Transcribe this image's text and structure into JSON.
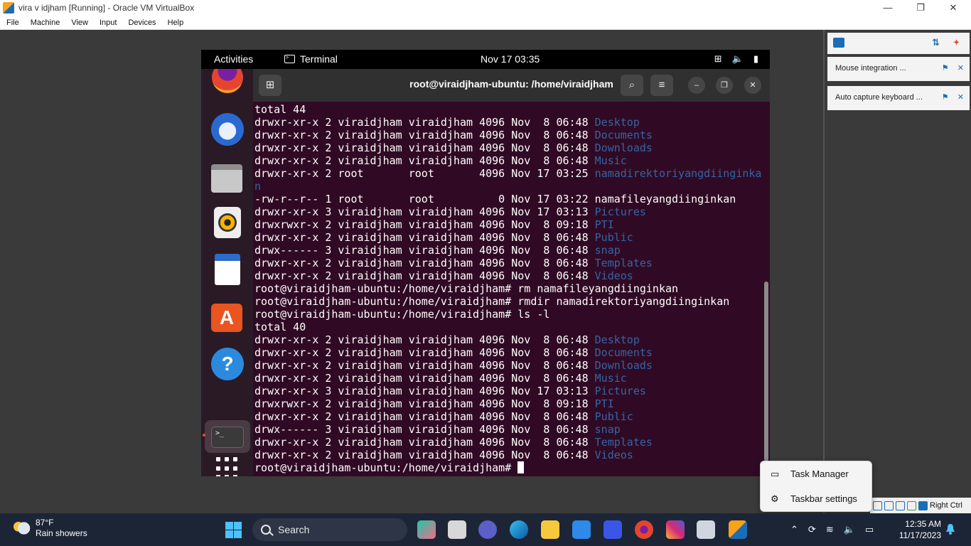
{
  "host_window": {
    "title": "vira v idjham  [Running] - Oracle VM VirtualBox",
    "controls": {
      "minimize": "—",
      "maximize": "❐",
      "close": "✕"
    },
    "menu": [
      "File",
      "Machine",
      "View",
      "Input",
      "Devices",
      "Help"
    ]
  },
  "guest": {
    "topbar": {
      "activities": "Activities",
      "app_name": "Terminal",
      "clock": "Nov 17  03:35"
    },
    "terminal": {
      "title": "root@viraidjham-ubuntu: /home/viraidjham",
      "lines": [
        [
          {
            "t": "total 44"
          }
        ],
        [
          {
            "t": "drwxr-xr-x 2 viraidjham viraidjham 4096 Nov  8 06:48 "
          },
          {
            "t": "Desktop",
            "d": true
          }
        ],
        [
          {
            "t": "drwxr-xr-x 2 viraidjham viraidjham 4096 Nov  8 06:48 "
          },
          {
            "t": "Documents",
            "d": true
          }
        ],
        [
          {
            "t": "drwxr-xr-x 2 viraidjham viraidjham 4096 Nov  8 06:48 "
          },
          {
            "t": "Downloads",
            "d": true
          }
        ],
        [
          {
            "t": "drwxr-xr-x 2 viraidjham viraidjham 4096 Nov  8 06:48 "
          },
          {
            "t": "Music",
            "d": true
          }
        ],
        [
          {
            "t": "drwxr-xr-x 2 root       root       4096 Nov 17 03:25 "
          },
          {
            "t": "namadirektoriyangdiinginka",
            "d": true
          }
        ],
        [
          {
            "t": "n",
            "d": true
          }
        ],
        [
          {
            "t": "-rw-r--r-- 1 root       root          0 Nov 17 03:22 namafileyangdiinginkan"
          }
        ],
        [
          {
            "t": "drwxr-xr-x 3 viraidjham viraidjham 4096 Nov 17 03:13 "
          },
          {
            "t": "Pictures",
            "d": true
          }
        ],
        [
          {
            "t": "drwxrwxr-x 2 viraidjham viraidjham 4096 Nov  8 09:18 "
          },
          {
            "t": "PTI",
            "d": true
          }
        ],
        [
          {
            "t": "drwxr-xr-x 2 viraidjham viraidjham 4096 Nov  8 06:48 "
          },
          {
            "t": "Public",
            "d": true
          }
        ],
        [
          {
            "t": "drwx------ 3 viraidjham viraidjham 4096 Nov  8 06:48 "
          },
          {
            "t": "snap",
            "d": true
          }
        ],
        [
          {
            "t": "drwxr-xr-x 2 viraidjham viraidjham 4096 Nov  8 06:48 "
          },
          {
            "t": "Templates",
            "d": true
          }
        ],
        [
          {
            "t": "drwxr-xr-x 2 viraidjham viraidjham 4096 Nov  8 06:48 "
          },
          {
            "t": "Videos",
            "d": true
          }
        ],
        [
          {
            "t": "root@viraidjham-ubuntu:/home/viraidjham# rm namafileyangdiinginkan"
          }
        ],
        [
          {
            "t": "root@viraidjham-ubuntu:/home/viraidjham# rmdir namadirektoriyangdiinginkan"
          }
        ],
        [
          {
            "t": "root@viraidjham-ubuntu:/home/viraidjham# ls -l"
          }
        ],
        [
          {
            "t": "total 40"
          }
        ],
        [
          {
            "t": "drwxr-xr-x 2 viraidjham viraidjham 4096 Nov  8 06:48 "
          },
          {
            "t": "Desktop",
            "d": true
          }
        ],
        [
          {
            "t": "drwxr-xr-x 2 viraidjham viraidjham 4096 Nov  8 06:48 "
          },
          {
            "t": "Documents",
            "d": true
          }
        ],
        [
          {
            "t": "drwxr-xr-x 2 viraidjham viraidjham 4096 Nov  8 06:48 "
          },
          {
            "t": "Downloads",
            "d": true
          }
        ],
        [
          {
            "t": "drwxr-xr-x 2 viraidjham viraidjham 4096 Nov  8 06:48 "
          },
          {
            "t": "Music",
            "d": true
          }
        ],
        [
          {
            "t": "drwxr-xr-x 3 viraidjham viraidjham 4096 Nov 17 03:13 "
          },
          {
            "t": "Pictures",
            "d": true
          }
        ],
        [
          {
            "t": "drwxrwxr-x 2 viraidjham viraidjham 4096 Nov  8 09:18 "
          },
          {
            "t": "PTI",
            "d": true
          }
        ],
        [
          {
            "t": "drwxr-xr-x 2 viraidjham viraidjham 4096 Nov  8 06:48 "
          },
          {
            "t": "Public",
            "d": true
          }
        ],
        [
          {
            "t": "drwx------ 3 viraidjham viraidjham 4096 Nov  8 06:48 "
          },
          {
            "t": "snap",
            "d": true
          }
        ],
        [
          {
            "t": "drwxr-xr-x 2 viraidjham viraidjham 4096 Nov  8 06:48 "
          },
          {
            "t": "Templates",
            "d": true
          }
        ],
        [
          {
            "t": "drwxr-xr-x 2 viraidjham viraidjham 4096 Nov  8 06:48 "
          },
          {
            "t": "Videos",
            "d": true
          }
        ],
        [
          {
            "t": "root@viraidjham-ubuntu:/home/viraidjham# "
          }
        ]
      ]
    },
    "dock_terminal_label": ">_"
  },
  "right_panel": {
    "notifications": [
      {
        "label": "Mouse integration ..."
      },
      {
        "label": "Auto capture keyboard ..."
      }
    ]
  },
  "context_menu": {
    "items": [
      {
        "label": "Task Manager"
      },
      {
        "label": "Taskbar settings"
      }
    ]
  },
  "vb_status": {
    "host_key": "Right Ctrl"
  },
  "taskbar": {
    "weather": {
      "temp": "87°F",
      "condition": "Rain showers"
    },
    "search_label": "Search",
    "clock": {
      "time": "12:35 AM",
      "date": "11/17/2023"
    }
  },
  "colors": {
    "terminal_bg": "#300a24",
    "dir_blue": "#3465a4",
    "ubuntu_orange": "#e95420",
    "taskbar_bg": "#1c2536"
  }
}
